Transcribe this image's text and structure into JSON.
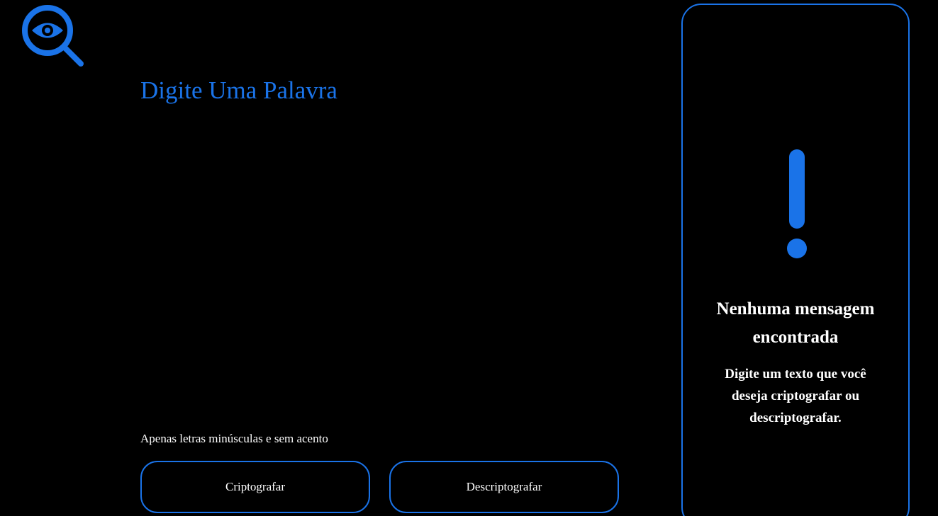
{
  "header": {
    "logo_icon": "magnifier-eye-icon"
  },
  "editor": {
    "value": "",
    "placeholder": "Digite Uma Palavra"
  },
  "hint": {
    "icon": "info-icon",
    "text": "Apenas letras minúsculas e sem acento"
  },
  "actions": {
    "encrypt_label": "Criptografar",
    "decrypt_label": "Descriptografar"
  },
  "output_panel": {
    "icon": "exclamation-icon",
    "title": "Nenhuma mensagem encontrada",
    "text": "Digite um texto que você deseja criptografar ou descriptografar."
  },
  "colors": {
    "accent": "#1a73e8",
    "background": "#000000",
    "text": "#ffffff"
  }
}
